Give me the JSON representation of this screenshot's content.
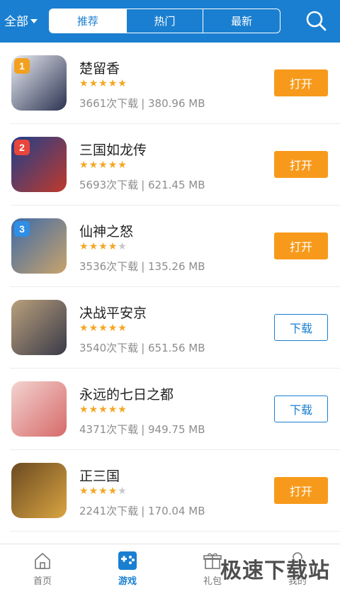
{
  "header": {
    "filter_label": "全部",
    "tabs": [
      {
        "label": "推荐",
        "active": true
      },
      {
        "label": "热门",
        "active": false
      },
      {
        "label": "最新",
        "active": false
      }
    ],
    "search_icon": "search-icon",
    "colors": {
      "bar": "#1a7fd0"
    }
  },
  "apps": [
    {
      "rank": "1",
      "name": "楚留香",
      "rating": 5,
      "downloads": "3661次下载",
      "size": "| 380.96 MB",
      "action": "打开",
      "action_type": "open",
      "rank_color": "#f2a01e",
      "icon_colors": [
        "#e9ecf3",
        "#2b3350"
      ]
    },
    {
      "rank": "2",
      "name": "三国如龙传",
      "rating": 5,
      "downloads": "5693次下载",
      "size": "| 621.45 MB",
      "action": "打开",
      "action_type": "open",
      "rank_color": "#e8453c",
      "icon_colors": [
        "#1d3f8c",
        "#c0392b"
      ]
    },
    {
      "rank": "3",
      "name": "仙神之怒",
      "rating": 4,
      "downloads": "3536次下载",
      "size": "| 135.26 MB",
      "action": "打开",
      "action_type": "open",
      "rank_color": "#2f8ee5",
      "icon_colors": [
        "#3d6aa8",
        "#c9a36b"
      ]
    },
    {
      "rank": "",
      "name": "决战平安京",
      "rating": 5,
      "downloads": "3540次下载",
      "size": "| 651.56 MB",
      "action": "下载",
      "action_type": "download",
      "rank_color": "",
      "icon_colors": [
        "#b9a07c",
        "#3a3a48"
      ]
    },
    {
      "rank": "",
      "name": "永远的七日之都",
      "rating": 5,
      "downloads": "4371次下载",
      "size": "| 949.75 MB",
      "action": "下载",
      "action_type": "download",
      "rank_color": "",
      "icon_colors": [
        "#f3d3d0",
        "#d66a6a"
      ]
    },
    {
      "rank": "",
      "name": "正三国",
      "rating": 4,
      "downloads": "2241次下载",
      "size": "| 170.04 MB",
      "action": "打开",
      "action_type": "open",
      "rank_color": "",
      "icon_colors": [
        "#6b4a22",
        "#d9a441"
      ]
    }
  ],
  "bottom_nav": [
    {
      "label": "首页",
      "icon": "home-icon",
      "active": false
    },
    {
      "label": "游戏",
      "icon": "gamepad-icon",
      "active": true
    },
    {
      "label": "礼包",
      "icon": "gift-icon",
      "active": false
    },
    {
      "label": "我的",
      "icon": "user-icon",
      "active": false
    }
  ],
  "watermark": "极速下载站"
}
